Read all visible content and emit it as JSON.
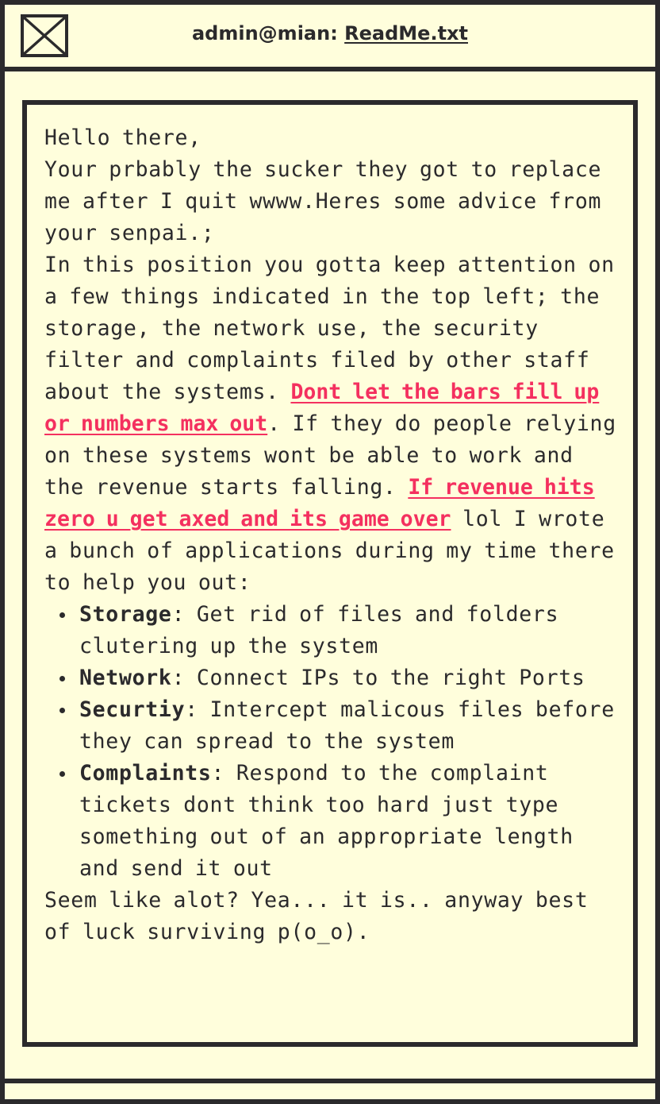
{
  "window": {
    "title_prefix": "admin@mian: ",
    "title_file": "ReadMe.txt",
    "close_icon": "close-x-icon"
  },
  "readme": {
    "greeting": "Hello there,",
    "intro": "Your prbably the sucker they got to replace me after I quit wwww.Heres some advice from your senpai.;",
    "para1": "In this position you gotta keep attention on a few things indicated in the top left; the storage, the network use, the security filter and complaints filed by other staff about the systems. ",
    "warning1": "Dont let the bars fill up or numbers max out",
    "para2": ". If they do people relying on these systems wont be able to work and the revenue starts falling. ",
    "warning2": "If revenue hits zero u get axed and its game over",
    "para3": " lol I wrote a bunch of applications during my time there to help you out:",
    "apps": [
      {
        "name": "Storage",
        "desc": ": Get rid of files and folders clutering up the system"
      },
      {
        "name": "Network",
        "desc": ": Connect IPs to the right Ports"
      },
      {
        "name": "Securtiy",
        "desc": ": Intercept malicous files before they can spread to the system"
      },
      {
        "name": "Complaints",
        "desc": ": Respond to the complaint tickets dont think too hard just type something out of an appropriate length and send it out"
      }
    ],
    "closing": "Seem like alot? Yea... it is.. anyway best of luck surviving p(o_o)."
  },
  "colors": {
    "background": "#fffedc",
    "border": "#2b2a2c",
    "highlight": "#f4305f"
  }
}
